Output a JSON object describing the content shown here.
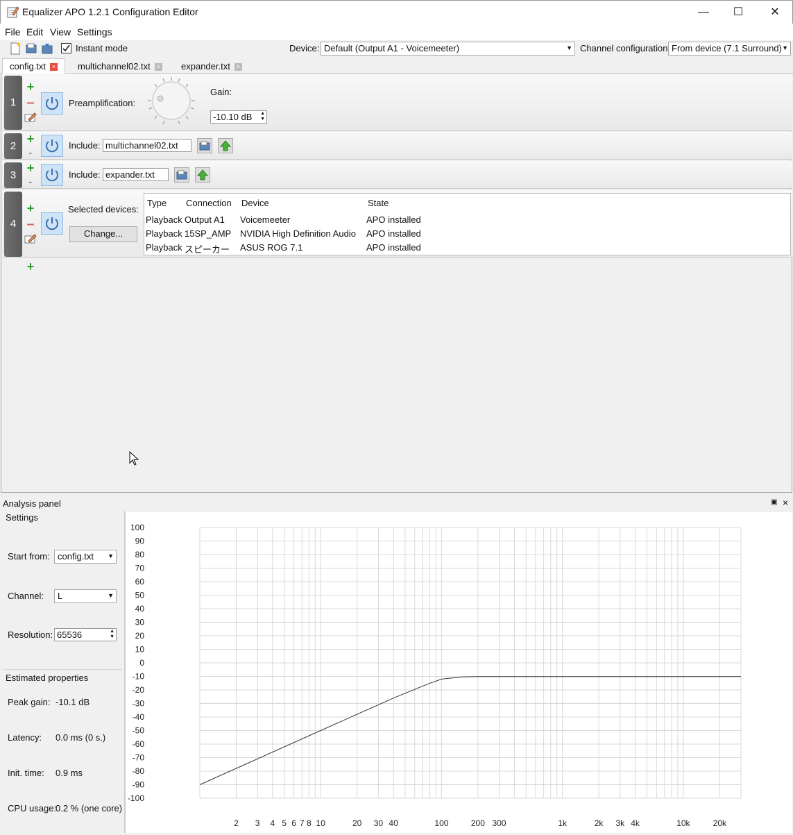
{
  "window": {
    "title": "Equalizer APO 1.2.1 Configuration Editor",
    "controls": {
      "minimize": "—",
      "maximize": "☐",
      "close": "✕"
    }
  },
  "menu": [
    "File",
    "Edit",
    "View",
    "Settings"
  ],
  "toolbar": {
    "instant_mode_label": "Instant mode",
    "instant_mode_checked": true,
    "device_label": "Device:",
    "device_value": "Default (Output A1 - Voicemeeter)",
    "channel_config_label": "Channel configuration:",
    "channel_config_value": "From device (7.1 Surround)"
  },
  "tabs": [
    {
      "label": "config.txt",
      "active": true
    },
    {
      "label": "multichannel02.txt",
      "active": false
    },
    {
      "label": "expander.txt",
      "active": false
    }
  ],
  "filters": [
    {
      "num": "1",
      "type": "preamp",
      "label": "Preamplification:",
      "gain_label": "Gain:",
      "gain_value": "-10.10 dB"
    },
    {
      "num": "2",
      "type": "include",
      "label": "Include:",
      "file": "multichannel02.txt"
    },
    {
      "num": "3",
      "type": "include",
      "label": "Include:",
      "file": "expander.txt"
    },
    {
      "num": "4",
      "type": "devices",
      "label": "Selected devices:",
      "change_button": "Change...",
      "columns": [
        "Type",
        "Connection",
        "Device",
        "State"
      ],
      "rows": [
        [
          "Playback",
          "Output A1",
          "Voicemeeter",
          "APO installed"
        ],
        [
          "Playback",
          "15SP_AMP",
          "NVIDIA High Definition Audio",
          "APO installed"
        ],
        [
          "Playback",
          "スピーカー",
          "ASUS ROG 7.1",
          "APO installed"
        ]
      ]
    }
  ],
  "analysis": {
    "title": "Analysis panel",
    "float_icon": "▣",
    "close_icon": "×",
    "settings_title": "Settings",
    "start_from_label": "Start from:",
    "start_from_value": "config.txt",
    "channel_label": "Channel:",
    "channel_value": "L",
    "resolution_label": "Resolution:",
    "resolution_value": "65536",
    "estimated_title": "Estimated properties",
    "peak_gain_label": "Peak gain:",
    "peak_gain_value": "-10.1 dB",
    "latency_label": "Latency:",
    "latency_value": "0.0 ms (0 s.)",
    "init_time_label": "Init. time:",
    "init_time_value": "0.9 ms",
    "cpu_label": "CPU usage:",
    "cpu_value": "0.2 % (one core)"
  },
  "chart_data": {
    "type": "line",
    "x_scale": "log",
    "xlim": [
      1,
      30000
    ],
    "ylim": [
      -100,
      100
    ],
    "y_ticks": [
      "100",
      "90",
      "80",
      "70",
      "60",
      "50",
      "40",
      "30",
      "20",
      "10",
      "0",
      "-10",
      "-20",
      "-30",
      "-40",
      "-50",
      "-60",
      "-70",
      "-80",
      "-90",
      "-100"
    ],
    "x_ticks": [
      {
        "v": 2,
        "label": "2"
      },
      {
        "v": 3,
        "label": "3"
      },
      {
        "v": 4,
        "label": "4"
      },
      {
        "v": 5,
        "label": "5"
      },
      {
        "v": 6,
        "label": "6"
      },
      {
        "v": 7,
        "label": "7"
      },
      {
        "v": 8,
        "label": "8"
      },
      {
        "v": 10,
        "label": "10"
      },
      {
        "v": 20,
        "label": "20"
      },
      {
        "v": 30,
        "label": "30"
      },
      {
        "v": 40,
        "label": "40"
      },
      {
        "v": 100,
        "label": "100"
      },
      {
        "v": 200,
        "label": "200"
      },
      {
        "v": 300,
        "label": "300"
      },
      {
        "v": 1000,
        "label": "1k"
      },
      {
        "v": 2000,
        "label": "2k"
      },
      {
        "v": 3000,
        "label": "3k"
      },
      {
        "v": 4000,
        "label": "4k"
      },
      {
        "v": 10000,
        "label": "10k"
      },
      {
        "v": 20000,
        "label": "20k"
      }
    ],
    "series": [
      {
        "x": [
          1,
          10,
          40,
          80,
          100,
          150,
          200,
          300,
          1000,
          30000
        ],
        "y": [
          -90,
          -50,
          -26,
          -15,
          -12,
          -10.4,
          -10.1,
          -10.1,
          -10.1,
          -10.1
        ]
      }
    ]
  }
}
